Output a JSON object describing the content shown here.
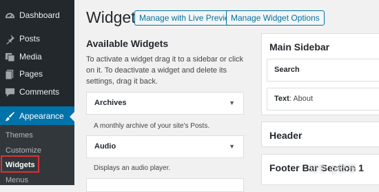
{
  "sidebar": {
    "items": [
      {
        "label": "Dashboard",
        "icon": "dashboard-icon"
      },
      {
        "label": "Posts",
        "icon": "pin-icon"
      },
      {
        "label": "Media",
        "icon": "media-icon"
      },
      {
        "label": "Pages",
        "icon": "pages-icon"
      },
      {
        "label": "Comments",
        "icon": "comments-icon"
      },
      {
        "label": "Appearance",
        "icon": "brush-icon",
        "current": true
      }
    ],
    "submenu": [
      "Themes",
      "Customize",
      "Widgets",
      "Menus"
    ],
    "current_submenu": "Widgets"
  },
  "header": {
    "title": "Widgets",
    "live_preview_label": "Manage with Live Preview",
    "widget_options_label": "Manage Widget Options"
  },
  "available": {
    "title": "Available Widgets",
    "description": "To activate a widget drag it to a sidebar or click on it. To deactivate a widget and delete its settings, drag it back.",
    "widgets": [
      {
        "name": "Archives",
        "description": "A monthly archive of your site's Posts."
      },
      {
        "name": "Audio",
        "description": "Displays an audio player."
      }
    ]
  },
  "sidebars": [
    {
      "title": "Main Sidebar",
      "widgets": [
        {
          "name": "Search",
          "suffix": ""
        },
        {
          "name": "Text",
          "suffix": ": About"
        }
      ]
    },
    {
      "title": "Header"
    },
    {
      "title": "Footer Bar Section 1"
    }
  ],
  "watermark": "知乎 @邱哥",
  "colors": {
    "sidebar_bg": "#23282d",
    "submenu_bg": "#32373c",
    "accent": "#0073aa",
    "button_text": "#0071a1",
    "highlight": "#dc3232"
  }
}
